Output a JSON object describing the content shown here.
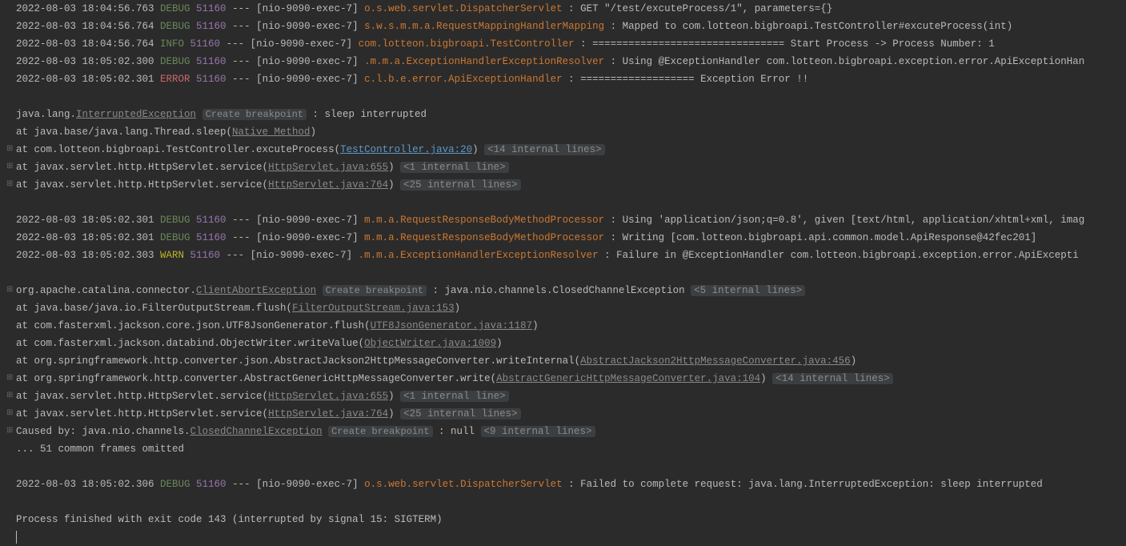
{
  "lines": [
    {
      "type": "log",
      "ts": "2022-08-03 18:04:56.763",
      "level": "DEBUG",
      "levelClass": "level-debug",
      "pid": "51160",
      "thread": "[nio-9090-exec-7]",
      "logger": "o.s.web.servlet.DispatcherServlet       ",
      "loggerClass": "logger-orange",
      "msg": ": GET \"/test/excuteProcess/1\", parameters={}"
    },
    {
      "type": "log",
      "ts": "2022-08-03 18:04:56.764",
      "level": "DEBUG",
      "levelClass": "level-debug",
      "pid": "51160",
      "thread": "[nio-9090-exec-7]",
      "logger": "s.w.s.m.m.a.RequestMappingHandlerMapping",
      "loggerClass": "logger-orange",
      "msg": ": Mapped to com.lotteon.bigbroapi.TestController#excuteProcess(int)"
    },
    {
      "type": "log",
      "ts": "2022-08-03 18:04:56.764",
      "level": " INFO",
      "levelClass": "level-info",
      "pid": "51160",
      "thread": "[nio-9090-exec-7]",
      "logger": "com.lotteon.bigbroapi.TestController    ",
      "loggerClass": "logger-orange",
      "msg": ": ================================ Start Process -> Process Number: 1"
    },
    {
      "type": "log",
      "ts": "2022-08-03 18:05:02.300",
      "level": "DEBUG",
      "levelClass": "level-debug",
      "pid": "51160",
      "thread": "[nio-9090-exec-7]",
      "logger": ".m.m.a.ExceptionHandlerExceptionResolver",
      "loggerClass": "logger-orange",
      "msg": ": Using @ExceptionHandler com.lotteon.bigbroapi.exception.error.ApiExceptionHan"
    },
    {
      "type": "log",
      "ts": "2022-08-03 18:05:02.301",
      "level": "ERROR",
      "levelClass": "level-error",
      "pid": "51160",
      "thread": "[nio-9090-exec-7]",
      "logger": "c.l.b.e.error.ApiExceptionHandler       ",
      "loggerClass": "logger-orange",
      "msg": ": =================== Exception Error !!"
    },
    {
      "type": "blank"
    },
    {
      "type": "exception-head",
      "prefix": "java.lang.",
      "exc": "InterruptedException",
      "breakpoint": "Create breakpoint",
      "suffix": " : sleep interrupted"
    },
    {
      "type": "stack-native",
      "prefix": "    at java.base/java.lang.Thread.sleep(",
      "link": "Native Method",
      "suffix": ")"
    },
    {
      "type": "stack-link-folded",
      "gutter": "⊞",
      "prefix": "    at com.lotteon.bigbroapi.TestController.excuteProcess(",
      "link": "TestController.java:20",
      "linkClass": "link-blue",
      "suffix": ") ",
      "folded": "<14 internal lines>"
    },
    {
      "type": "stack-link-folded",
      "gutter": "⊞",
      "prefix": "    at javax.servlet.http.HttpServlet.service(",
      "link": "HttpServlet.java:655",
      "linkClass": "link-grey",
      "suffix": ") ",
      "folded": "<1 internal line>"
    },
    {
      "type": "stack-link-folded",
      "gutter": "⊞",
      "prefix": "    at javax.servlet.http.HttpServlet.service(",
      "link": "HttpServlet.java:764",
      "linkClass": "link-grey",
      "suffix": ") ",
      "folded": "<25 internal lines>"
    },
    {
      "type": "blank"
    },
    {
      "type": "log",
      "ts": "2022-08-03 18:05:02.301",
      "level": "DEBUG",
      "levelClass": "level-debug",
      "pid": "51160",
      "thread": "[nio-9090-exec-7]",
      "logger": "m.m.a.RequestResponseBodyMethodProcessor",
      "loggerClass": "logger-orange",
      "msg": ": Using 'application/json;q=0.8', given [text/html, application/xhtml+xml, imag"
    },
    {
      "type": "log",
      "ts": "2022-08-03 18:05:02.301",
      "level": "DEBUG",
      "levelClass": "level-debug",
      "pid": "51160",
      "thread": "[nio-9090-exec-7]",
      "logger": "m.m.a.RequestResponseBodyMethodProcessor",
      "loggerClass": "logger-orange",
      "msg": ": Writing [com.lotteon.bigbroapi.api.common.model.ApiResponse@42fec201]"
    },
    {
      "type": "log",
      "ts": "2022-08-03 18:05:02.303",
      "level": " WARN",
      "levelClass": "level-warn",
      "pid": "51160",
      "thread": "[nio-9090-exec-7]",
      "logger": ".m.m.a.ExceptionHandlerExceptionResolver",
      "loggerClass": "logger-orange",
      "msg": ": Failure in @ExceptionHandler com.lotteon.bigbroapi.exception.error.ApiExcepti"
    },
    {
      "type": "blank"
    },
    {
      "type": "exception-head2",
      "gutter": "⊞",
      "prefix": "org.apache.catalina.connector.",
      "exc": "ClientAbortException",
      "breakpoint": "Create breakpoint",
      "mid": " : java.nio.channels.ClosedChannelException ",
      "folded": "<5 internal lines>"
    },
    {
      "type": "stack-link",
      "prefix": "    at java.base/java.io.FilterOutputStream.flush(",
      "link": "FilterOutputStream.java:153",
      "linkClass": "link-grey",
      "suffix": ")"
    },
    {
      "type": "stack-link",
      "prefix": "    at com.fasterxml.jackson.core.json.UTF8JsonGenerator.flush(",
      "link": "UTF8JsonGenerator.java:1187",
      "linkClass": "link-grey",
      "suffix": ")"
    },
    {
      "type": "stack-link",
      "prefix": "    at com.fasterxml.jackson.databind.ObjectWriter.writeValue(",
      "link": "ObjectWriter.java:1009",
      "linkClass": "link-grey",
      "suffix": ")"
    },
    {
      "type": "stack-link",
      "prefix": "    at org.springframework.http.converter.json.AbstractJackson2HttpMessageConverter.writeInternal(",
      "link": "AbstractJackson2HttpMessageConverter.java:456",
      "linkClass": "link-grey",
      "suffix": ")"
    },
    {
      "type": "stack-link-folded",
      "gutter": "⊞",
      "prefix": "    at org.springframework.http.converter.AbstractGenericHttpMessageConverter.write(",
      "link": "AbstractGenericHttpMessageConverter.java:104",
      "linkClass": "link-grey",
      "suffix": ") ",
      "folded": "<14 internal lines>"
    },
    {
      "type": "stack-link-folded",
      "gutter": "⊞",
      "prefix": "    at javax.servlet.http.HttpServlet.service(",
      "link": "HttpServlet.java:655",
      "linkClass": "link-grey",
      "suffix": ") ",
      "folded": "<1 internal line>"
    },
    {
      "type": "stack-link-folded",
      "gutter": "⊞",
      "prefix": "    at javax.servlet.http.HttpServlet.service(",
      "link": "HttpServlet.java:764",
      "linkClass": "link-grey",
      "suffix": ") ",
      "folded": "<25 internal lines>"
    },
    {
      "type": "caused-by",
      "gutter": "⊞",
      "prefix": "Caused by: java.nio.channels.",
      "exc": "ClosedChannelException",
      "breakpoint": "Create breakpoint",
      "mid": " : null ",
      "folded": "<9 internal lines>"
    },
    {
      "type": "plain",
      "text": "    ... 51 common frames omitted"
    },
    {
      "type": "blank"
    },
    {
      "type": "log",
      "ts": "2022-08-03 18:05:02.306",
      "level": "DEBUG",
      "levelClass": "level-debug",
      "pid": "51160",
      "thread": "[nio-9090-exec-7]",
      "logger": "o.s.web.servlet.DispatcherServlet       ",
      "loggerClass": "logger-orange",
      "msg": ": Failed to complete request: java.lang.InterruptedException: sleep interrupted"
    },
    {
      "type": "blank"
    },
    {
      "type": "plain",
      "text": "Process finished with exit code 143 (interrupted by signal 15: SIGTERM)"
    },
    {
      "type": "cursor"
    }
  ],
  "sep": " --- "
}
